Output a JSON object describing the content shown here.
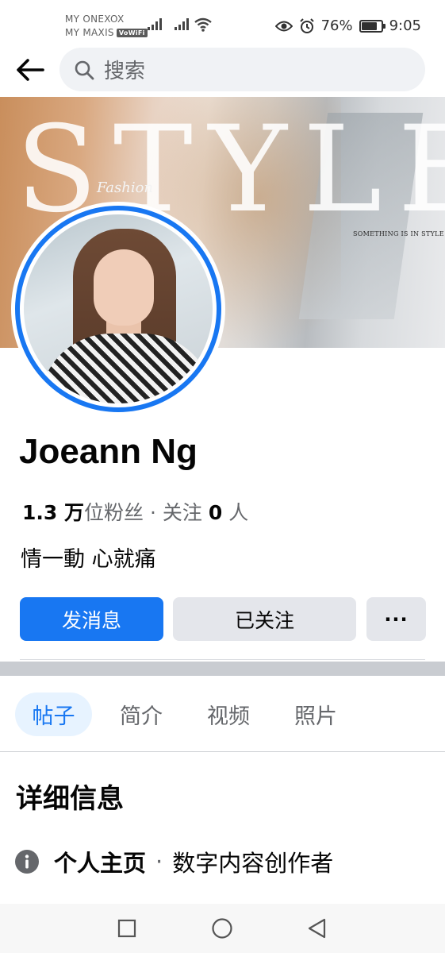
{
  "status_bar": {
    "carrier_1": "MY ONEXOX",
    "carrier_2": "MY MAXIS",
    "vowifi_badge": "VoWiFi",
    "battery_percent": "76%",
    "battery_level": 0.76,
    "time": "9:05",
    "icons": [
      "signal-icon",
      "signal-icon",
      "wifi-icon",
      "eye-icon",
      "alarm-icon",
      "battery-icon"
    ]
  },
  "header": {
    "back_icon": "arrow-left-icon",
    "search_icon": "magnifier-icon",
    "search_placeholder": "搜索"
  },
  "cover": {
    "headline": "STYLE",
    "script_word": "Fashion",
    "tagline": "SOMETHING IS IN STYLE"
  },
  "profile": {
    "name": "Joeann Ng",
    "followers_count": "1.3 万",
    "followers_unit": "位粉丝",
    "separator": "·",
    "following_label": "关注",
    "following_count": "0",
    "following_unit": "人",
    "bio": "情一動 心就痛"
  },
  "actions": {
    "message_label": "发消息",
    "following_label": "已关注",
    "more_label": "···"
  },
  "tabs": [
    {
      "label": "帖子",
      "active": true
    },
    {
      "label": "简介",
      "active": false
    },
    {
      "label": "视频",
      "active": false
    },
    {
      "label": "照片",
      "active": false
    }
  ],
  "details": {
    "title": "详细信息",
    "row_icon": "info-icon",
    "row_label": "个人主页",
    "row_separator": "·",
    "row_value": "数字内容创作者"
  },
  "nav_bar": {
    "icons": [
      "recent-apps-icon",
      "home-icon",
      "back-icon"
    ]
  },
  "colors": {
    "accent": "#1877f2",
    "secondary_button": "#e4e6eb",
    "muted_text": "#65676b",
    "active_tab_bg": "#e7f3ff"
  }
}
